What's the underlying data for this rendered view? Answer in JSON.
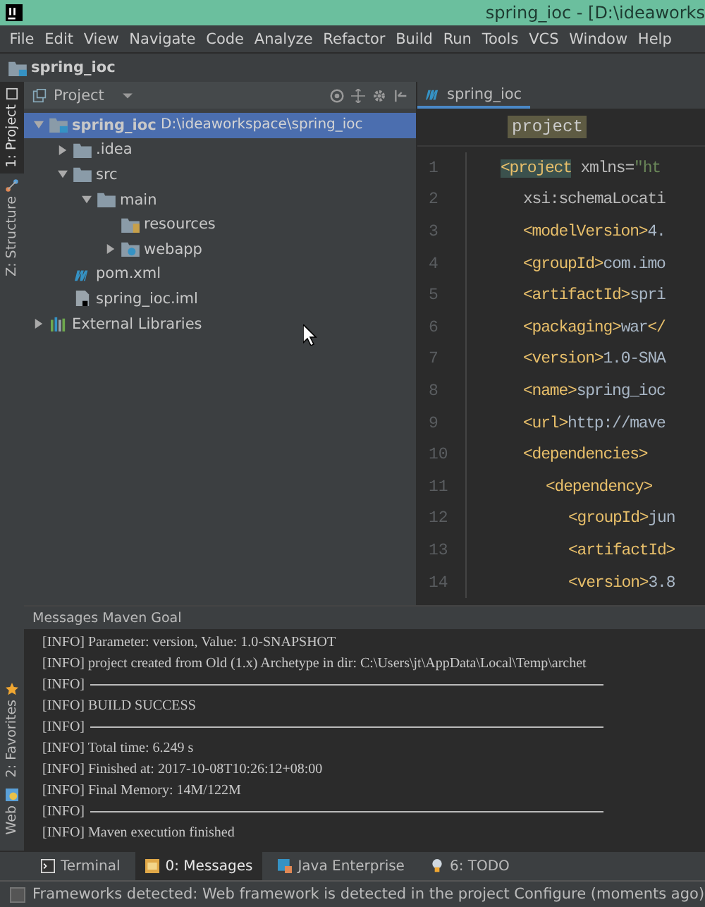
{
  "window": {
    "title": "spring_ioc - [D:\\ideaworks"
  },
  "menu": [
    "File",
    "Edit",
    "View",
    "Navigate",
    "Code",
    "Analyze",
    "Refactor",
    "Build",
    "Run",
    "Tools",
    "VCS",
    "Window",
    "Help"
  ],
  "breadcrumb": "spring_ioc",
  "left_stripe": [
    {
      "label": "1: Project",
      "selected": true,
      "kind": "project"
    },
    {
      "label": "Z: Structure",
      "selected": false,
      "kind": "structure"
    },
    {
      "label": "2: Favorites",
      "selected": false,
      "kind": "favorites"
    },
    {
      "label": "Web",
      "selected": false,
      "kind": "web"
    }
  ],
  "project_panel": {
    "title": "Project",
    "tree": [
      {
        "label": "spring_ioc",
        "path": "D:\\ideaworkspace\\spring_ioc",
        "kind": "module",
        "expanded": true,
        "selected": true,
        "children": [
          {
            "label": ".idea",
            "kind": "folder",
            "expanded": false,
            "selected": false
          },
          {
            "label": "src",
            "kind": "folder",
            "expanded": true,
            "selected": false,
            "children": [
              {
                "label": "main",
                "kind": "folder",
                "expanded": true,
                "selected": false,
                "children": [
                  {
                    "label": "resources",
                    "kind": "resource-folder",
                    "selected": false
                  },
                  {
                    "label": "webapp",
                    "kind": "web-folder",
                    "expanded": false,
                    "selected": false
                  }
                ]
              }
            ]
          },
          {
            "label": "pom.xml",
            "kind": "maven",
            "selected": false
          },
          {
            "label": "spring_ioc.iml",
            "kind": "iml",
            "selected": false
          }
        ]
      },
      {
        "label": "External Libraries",
        "kind": "library",
        "expanded": false,
        "selected": false
      }
    ]
  },
  "editor": {
    "tab": "spring_ioc",
    "breadcrumb": "project",
    "lines": [
      {
        "number": "1",
        "segments": [
          {
            "kind": "tag-hl",
            "text": "<project"
          },
          {
            "kind": "attr",
            "text": " xmlns="
          },
          {
            "kind": "string",
            "text": "\"ht"
          }
        ],
        "children": [
          {
            "number": "2",
            "segments": [
              {
                "kind": "attr",
                "text": "xsi:schemaLocati"
              }
            ]
          },
          {
            "number": "3",
            "segments": [
              {
                "kind": "tag",
                "text": "<modelVersion>"
              },
              {
                "kind": "text",
                "text": "4."
              }
            ]
          },
          {
            "number": "4",
            "segments": [
              {
                "kind": "tag",
                "text": "<groupId>"
              },
              {
                "kind": "text",
                "text": "com.imo"
              }
            ]
          },
          {
            "number": "5",
            "segments": [
              {
                "kind": "tag",
                "text": "<artifactId>"
              },
              {
                "kind": "text",
                "text": "spri"
              }
            ]
          },
          {
            "number": "6",
            "segments": [
              {
                "kind": "tag",
                "text": "<packaging>"
              },
              {
                "kind": "text",
                "text": "war"
              },
              {
                "kind": "tag",
                "text": "</"
              }
            ]
          },
          {
            "number": "7",
            "segments": [
              {
                "kind": "tag",
                "text": "<version>"
              },
              {
                "kind": "text",
                "text": "1.0-SNA"
              }
            ]
          },
          {
            "number": "8",
            "segments": [
              {
                "kind": "tag",
                "text": "<name>"
              },
              {
                "kind": "text",
                "text": "spring_ioc"
              }
            ]
          },
          {
            "number": "9",
            "segments": [
              {
                "kind": "tag",
                "text": "<url>"
              },
              {
                "kind": "text",
                "text": "http://mave"
              }
            ]
          },
          {
            "number": "10",
            "segments": [
              {
                "kind": "tag",
                "text": "<dependencies>"
              }
            ],
            "children": [
              {
                "number": "11",
                "segments": [
                  {
                    "kind": "tag",
                    "text": "<dependency>"
                  }
                ],
                "children": [
                  {
                    "number": "12",
                    "segments": [
                      {
                        "kind": "tag",
                        "text": "<groupId>"
                      },
                      {
                        "kind": "text",
                        "text": "jun"
                      }
                    ]
                  },
                  {
                    "number": "13",
                    "segments": [
                      {
                        "kind": "tag",
                        "text": "<artifactId>"
                      }
                    ]
                  },
                  {
                    "number": "14",
                    "segments": [
                      {
                        "kind": "tag",
                        "text": "<version>"
                      },
                      {
                        "kind": "text",
                        "text": "3.8"
                      }
                    ]
                  }
                ]
              }
            ]
          }
        ]
      }
    ]
  },
  "messages_panel": {
    "title": "Messages Maven Goal",
    "lines": [
      {
        "kind": "text",
        "text": "[INFO] Parameter: version, Value: 1.0-SNAPSHOT"
      },
      {
        "kind": "text",
        "text": "[INFO] project created from Old (1.x) Archetype in dir: C:\\Users\\jt\\AppData\\Local\\Temp\\archet"
      },
      {
        "kind": "rule",
        "text": "[INFO]"
      },
      {
        "kind": "text",
        "text": "[INFO] BUILD SUCCESS"
      },
      {
        "kind": "rule",
        "text": "[INFO]"
      },
      {
        "kind": "text",
        "text": "[INFO] Total time: 6.249 s"
      },
      {
        "kind": "text",
        "text": "[INFO] Finished at: 2017-10-08T10:26:12+08:00"
      },
      {
        "kind": "text",
        "text": "[INFO] Final Memory: 14M/122M"
      },
      {
        "kind": "rule",
        "text": "[INFO]"
      },
      {
        "kind": "text",
        "text": "[INFO] Maven execution finished"
      }
    ]
  },
  "tool_tabs": [
    {
      "label": "Terminal",
      "kind": "terminal",
      "selected": false
    },
    {
      "label": "0: Messages",
      "kind": "messages",
      "selected": true
    },
    {
      "label": "Java Enterprise",
      "kind": "java-ee",
      "selected": false
    },
    {
      "label": "6: TODO",
      "kind": "todo",
      "selected": false
    }
  ],
  "status_bar": "Frameworks detected: Web framework is detected in the project Configure (moments ago)"
}
